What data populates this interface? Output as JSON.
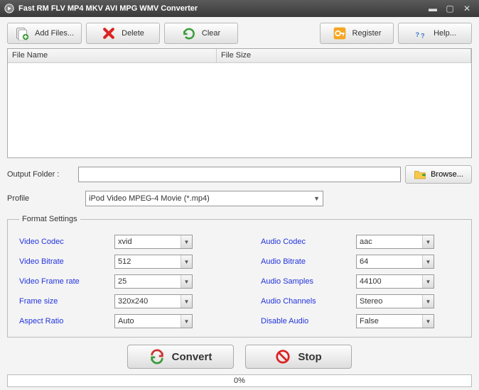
{
  "title": "Fast RM FLV MP4 MKV AVI MPG WMV Converter",
  "toolbar": {
    "add_files": "Add Files...",
    "delete": "Delete",
    "clear": "Clear",
    "register": "Register",
    "help": "Help..."
  },
  "filelist": {
    "col_filename": "File Name",
    "col_filesize": "File Size"
  },
  "output": {
    "label": "Output Folder :",
    "value": "",
    "browse": "Browse..."
  },
  "profile": {
    "label": "Profile",
    "value": "iPod Video MPEG-4 Movie (*.mp4)"
  },
  "format": {
    "legend": "Format Settings",
    "video_codec": {
      "label": "Video Codec",
      "value": "xvid"
    },
    "video_bitrate": {
      "label": "Video Bitrate",
      "value": "512"
    },
    "video_framerate": {
      "label": "Video Frame rate",
      "value": "25"
    },
    "frame_size": {
      "label": "Frame size",
      "value": "320x240"
    },
    "aspect_ratio": {
      "label": "Aspect Ratio",
      "value": "Auto"
    },
    "audio_codec": {
      "label": "Audio Codec",
      "value": "aac"
    },
    "audio_bitrate": {
      "label": "Audio Bitrate",
      "value": "64"
    },
    "audio_samples": {
      "label": "Audio Samples",
      "value": "44100"
    },
    "audio_channels": {
      "label": "Audio Channels",
      "value": "Stereo"
    },
    "disable_audio": {
      "label": "Disable Audio",
      "value": "False"
    }
  },
  "actions": {
    "convert": "Convert",
    "stop": "Stop"
  },
  "progress_text": "0%"
}
